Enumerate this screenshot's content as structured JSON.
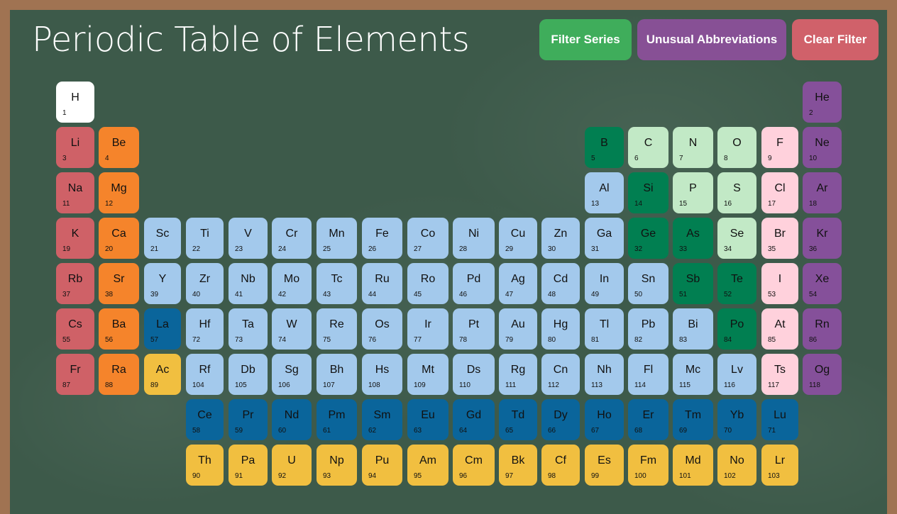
{
  "title": "Periodic Table of Elements",
  "buttons": {
    "filter_series": "Filter Series",
    "unusual_abbreviations": "Unusual Abbreviations",
    "clear_filter": "Clear Filter"
  },
  "colors": {
    "board": "#3d5a4a",
    "frame": "#a07352",
    "filter_series_button": "#3fad5b",
    "unusual_abbreviations_button": "#875095",
    "clear_filter_button": "#d0616a",
    "hydrogen": "#ffffff",
    "alkali": "#cf6167",
    "alkaline": "#f5842b",
    "transition": "#a3c9ec",
    "lanthanide": "#0a659b",
    "actinide": "#f1bf40",
    "metalloid": "#017f51",
    "nonmetal": "#c2e9c6",
    "halogen": "#ffd1dc",
    "noble": "#85509a"
  },
  "elements": [
    {
      "sym": "H",
      "num": 1,
      "row": 1,
      "col": 1,
      "cat": "hydrogen"
    },
    {
      "sym": "He",
      "num": 2,
      "row": 1,
      "col": 18,
      "cat": "noble"
    },
    {
      "sym": "Li",
      "num": 3,
      "row": 2,
      "col": 1,
      "cat": "alkali"
    },
    {
      "sym": "Be",
      "num": 4,
      "row": 2,
      "col": 2,
      "cat": "alkaline"
    },
    {
      "sym": "B",
      "num": 5,
      "row": 2,
      "col": 13,
      "cat": "metalloid"
    },
    {
      "sym": "C",
      "num": 6,
      "row": 2,
      "col": 14,
      "cat": "nonmetal"
    },
    {
      "sym": "N",
      "num": 7,
      "row": 2,
      "col": 15,
      "cat": "nonmetal"
    },
    {
      "sym": "O",
      "num": 8,
      "row": 2,
      "col": 16,
      "cat": "nonmetal"
    },
    {
      "sym": "F",
      "num": 9,
      "row": 2,
      "col": 17,
      "cat": "halogen"
    },
    {
      "sym": "Ne",
      "num": 10,
      "row": 2,
      "col": 18,
      "cat": "noble"
    },
    {
      "sym": "Na",
      "num": 11,
      "row": 3,
      "col": 1,
      "cat": "alkali"
    },
    {
      "sym": "Mg",
      "num": 12,
      "row": 3,
      "col": 2,
      "cat": "alkaline"
    },
    {
      "sym": "Al",
      "num": 13,
      "row": 3,
      "col": 13,
      "cat": "transition"
    },
    {
      "sym": "Si",
      "num": 14,
      "row": 3,
      "col": 14,
      "cat": "metalloid"
    },
    {
      "sym": "P",
      "num": 15,
      "row": 3,
      "col": 15,
      "cat": "nonmetal"
    },
    {
      "sym": "S",
      "num": 16,
      "row": 3,
      "col": 16,
      "cat": "nonmetal"
    },
    {
      "sym": "Cl",
      "num": 17,
      "row": 3,
      "col": 17,
      "cat": "halogen"
    },
    {
      "sym": "Ar",
      "num": 18,
      "row": 3,
      "col": 18,
      "cat": "noble"
    },
    {
      "sym": "K",
      "num": 19,
      "row": 4,
      "col": 1,
      "cat": "alkali"
    },
    {
      "sym": "Ca",
      "num": 20,
      "row": 4,
      "col": 2,
      "cat": "alkaline"
    },
    {
      "sym": "Sc",
      "num": 21,
      "row": 4,
      "col": 3,
      "cat": "transition"
    },
    {
      "sym": "Ti",
      "num": 22,
      "row": 4,
      "col": 4,
      "cat": "transition"
    },
    {
      "sym": "V",
      "num": 23,
      "row": 4,
      "col": 5,
      "cat": "transition"
    },
    {
      "sym": "Cr",
      "num": 24,
      "row": 4,
      "col": 6,
      "cat": "transition"
    },
    {
      "sym": "Mn",
      "num": 25,
      "row": 4,
      "col": 7,
      "cat": "transition"
    },
    {
      "sym": "Fe",
      "num": 26,
      "row": 4,
      "col": 8,
      "cat": "transition"
    },
    {
      "sym": "Co",
      "num": 27,
      "row": 4,
      "col": 9,
      "cat": "transition"
    },
    {
      "sym": "Ni",
      "num": 28,
      "row": 4,
      "col": 10,
      "cat": "transition"
    },
    {
      "sym": "Cu",
      "num": 29,
      "row": 4,
      "col": 11,
      "cat": "transition"
    },
    {
      "sym": "Zn",
      "num": 30,
      "row": 4,
      "col": 12,
      "cat": "transition"
    },
    {
      "sym": "Ga",
      "num": 31,
      "row": 4,
      "col": 13,
      "cat": "transition"
    },
    {
      "sym": "Ge",
      "num": 32,
      "row": 4,
      "col": 14,
      "cat": "metalloid"
    },
    {
      "sym": "As",
      "num": 33,
      "row": 4,
      "col": 15,
      "cat": "metalloid"
    },
    {
      "sym": "Se",
      "num": 34,
      "row": 4,
      "col": 16,
      "cat": "nonmetal"
    },
    {
      "sym": "Br",
      "num": 35,
      "row": 4,
      "col": 17,
      "cat": "halogen"
    },
    {
      "sym": "Kr",
      "num": 36,
      "row": 4,
      "col": 18,
      "cat": "noble"
    },
    {
      "sym": "Rb",
      "num": 37,
      "row": 5,
      "col": 1,
      "cat": "alkali"
    },
    {
      "sym": "Sr",
      "num": 38,
      "row": 5,
      "col": 2,
      "cat": "alkaline"
    },
    {
      "sym": "Y",
      "num": 39,
      "row": 5,
      "col": 3,
      "cat": "transition"
    },
    {
      "sym": "Zr",
      "num": 40,
      "row": 5,
      "col": 4,
      "cat": "transition"
    },
    {
      "sym": "Nb",
      "num": 41,
      "row": 5,
      "col": 5,
      "cat": "transition"
    },
    {
      "sym": "Mo",
      "num": 42,
      "row": 5,
      "col": 6,
      "cat": "transition"
    },
    {
      "sym": "Tc",
      "num": 43,
      "row": 5,
      "col": 7,
      "cat": "transition"
    },
    {
      "sym": "Ru",
      "num": 44,
      "row": 5,
      "col": 8,
      "cat": "transition"
    },
    {
      "sym": "Ro",
      "num": 45,
      "row": 5,
      "col": 9,
      "cat": "transition"
    },
    {
      "sym": "Pd",
      "num": 46,
      "row": 5,
      "col": 10,
      "cat": "transition"
    },
    {
      "sym": "Ag",
      "num": 47,
      "row": 5,
      "col": 11,
      "cat": "transition"
    },
    {
      "sym": "Cd",
      "num": 48,
      "row": 5,
      "col": 12,
      "cat": "transition"
    },
    {
      "sym": "In",
      "num": 49,
      "row": 5,
      "col": 13,
      "cat": "transition"
    },
    {
      "sym": "Sn",
      "num": 50,
      "row": 5,
      "col": 14,
      "cat": "transition"
    },
    {
      "sym": "Sb",
      "num": 51,
      "row": 5,
      "col": 15,
      "cat": "metalloid"
    },
    {
      "sym": "Te",
      "num": 52,
      "row": 5,
      "col": 16,
      "cat": "metalloid"
    },
    {
      "sym": "I",
      "num": 53,
      "row": 5,
      "col": 17,
      "cat": "halogen"
    },
    {
      "sym": "Xe",
      "num": 54,
      "row": 5,
      "col": 18,
      "cat": "noble"
    },
    {
      "sym": "Cs",
      "num": 55,
      "row": 6,
      "col": 1,
      "cat": "alkali"
    },
    {
      "sym": "Ba",
      "num": 56,
      "row": 6,
      "col": 2,
      "cat": "alkaline"
    },
    {
      "sym": "La",
      "num": 57,
      "row": 6,
      "col": 3,
      "cat": "lanthanide"
    },
    {
      "sym": "Hf",
      "num": 72,
      "row": 6,
      "col": 4,
      "cat": "transition"
    },
    {
      "sym": "Ta",
      "num": 73,
      "row": 6,
      "col": 5,
      "cat": "transition"
    },
    {
      "sym": "W",
      "num": 74,
      "row": 6,
      "col": 6,
      "cat": "transition"
    },
    {
      "sym": "Re",
      "num": 75,
      "row": 6,
      "col": 7,
      "cat": "transition"
    },
    {
      "sym": "Os",
      "num": 76,
      "row": 6,
      "col": 8,
      "cat": "transition"
    },
    {
      "sym": "Ir",
      "num": 77,
      "row": 6,
      "col": 9,
      "cat": "transition"
    },
    {
      "sym": "Pt",
      "num": 78,
      "row": 6,
      "col": 10,
      "cat": "transition"
    },
    {
      "sym": "Au",
      "num": 79,
      "row": 6,
      "col": 11,
      "cat": "transition"
    },
    {
      "sym": "Hg",
      "num": 80,
      "row": 6,
      "col": 12,
      "cat": "transition"
    },
    {
      "sym": "Tl",
      "num": 81,
      "row": 6,
      "col": 13,
      "cat": "transition"
    },
    {
      "sym": "Pb",
      "num": 82,
      "row": 6,
      "col": 14,
      "cat": "transition"
    },
    {
      "sym": "Bi",
      "num": 83,
      "row": 6,
      "col": 15,
      "cat": "transition"
    },
    {
      "sym": "Po",
      "num": 84,
      "row": 6,
      "col": 16,
      "cat": "metalloid"
    },
    {
      "sym": "At",
      "num": 85,
      "row": 6,
      "col": 17,
      "cat": "halogen"
    },
    {
      "sym": "Rn",
      "num": 86,
      "row": 6,
      "col": 18,
      "cat": "noble"
    },
    {
      "sym": "Fr",
      "num": 87,
      "row": 7,
      "col": 1,
      "cat": "alkali"
    },
    {
      "sym": "Ra",
      "num": 88,
      "row": 7,
      "col": 2,
      "cat": "alkaline"
    },
    {
      "sym": "Ac",
      "num": 89,
      "row": 7,
      "col": 3,
      "cat": "actinide"
    },
    {
      "sym": "Rf",
      "num": 104,
      "row": 7,
      "col": 4,
      "cat": "transition"
    },
    {
      "sym": "Db",
      "num": 105,
      "row": 7,
      "col": 5,
      "cat": "transition"
    },
    {
      "sym": "Sg",
      "num": 106,
      "row": 7,
      "col": 6,
      "cat": "transition"
    },
    {
      "sym": "Bh",
      "num": 107,
      "row": 7,
      "col": 7,
      "cat": "transition"
    },
    {
      "sym": "Hs",
      "num": 108,
      "row": 7,
      "col": 8,
      "cat": "transition"
    },
    {
      "sym": "Mt",
      "num": 109,
      "row": 7,
      "col": 9,
      "cat": "transition"
    },
    {
      "sym": "Ds",
      "num": 110,
      "row": 7,
      "col": 10,
      "cat": "transition"
    },
    {
      "sym": "Rg",
      "num": 111,
      "row": 7,
      "col": 11,
      "cat": "transition"
    },
    {
      "sym": "Cn",
      "num": 112,
      "row": 7,
      "col": 12,
      "cat": "transition"
    },
    {
      "sym": "Nh",
      "num": 113,
      "row": 7,
      "col": 13,
      "cat": "transition"
    },
    {
      "sym": "Fl",
      "num": 114,
      "row": 7,
      "col": 14,
      "cat": "transition"
    },
    {
      "sym": "Mc",
      "num": 115,
      "row": 7,
      "col": 15,
      "cat": "transition"
    },
    {
      "sym": "Lv",
      "num": 116,
      "row": 7,
      "col": 16,
      "cat": "transition"
    },
    {
      "sym": "Ts",
      "num": 117,
      "row": 7,
      "col": 17,
      "cat": "halogen"
    },
    {
      "sym": "Og",
      "num": 118,
      "row": 7,
      "col": 18,
      "cat": "noble"
    },
    {
      "sym": "Ce",
      "num": 58,
      "row": 8,
      "col": 4,
      "cat": "lanthanide"
    },
    {
      "sym": "Pr",
      "num": 59,
      "row": 8,
      "col": 5,
      "cat": "lanthanide"
    },
    {
      "sym": "Nd",
      "num": 60,
      "row": 8,
      "col": 6,
      "cat": "lanthanide"
    },
    {
      "sym": "Pm",
      "num": 61,
      "row": 8,
      "col": 7,
      "cat": "lanthanide"
    },
    {
      "sym": "Sm",
      "num": 62,
      "row": 8,
      "col": 8,
      "cat": "lanthanide"
    },
    {
      "sym": "Eu",
      "num": 63,
      "row": 8,
      "col": 9,
      "cat": "lanthanide"
    },
    {
      "sym": "Gd",
      "num": 64,
      "row": 8,
      "col": 10,
      "cat": "lanthanide"
    },
    {
      "sym": "Td",
      "num": 65,
      "row": 8,
      "col": 11,
      "cat": "lanthanide"
    },
    {
      "sym": "Dy",
      "num": 66,
      "row": 8,
      "col": 12,
      "cat": "lanthanide"
    },
    {
      "sym": "Ho",
      "num": 67,
      "row": 8,
      "col": 13,
      "cat": "lanthanide"
    },
    {
      "sym": "Er",
      "num": 68,
      "row": 8,
      "col": 14,
      "cat": "lanthanide"
    },
    {
      "sym": "Tm",
      "num": 69,
      "row": 8,
      "col": 15,
      "cat": "lanthanide"
    },
    {
      "sym": "Yb",
      "num": 70,
      "row": 8,
      "col": 16,
      "cat": "lanthanide"
    },
    {
      "sym": "Lu",
      "num": 71,
      "row": 8,
      "col": 17,
      "cat": "lanthanide"
    },
    {
      "sym": "Th",
      "num": 90,
      "row": 9,
      "col": 4,
      "cat": "actinide"
    },
    {
      "sym": "Pa",
      "num": 91,
      "row": 9,
      "col": 5,
      "cat": "actinide"
    },
    {
      "sym": "U",
      "num": 92,
      "row": 9,
      "col": 6,
      "cat": "actinide"
    },
    {
      "sym": "Np",
      "num": 93,
      "row": 9,
      "col": 7,
      "cat": "actinide"
    },
    {
      "sym": "Pu",
      "num": 94,
      "row": 9,
      "col": 8,
      "cat": "actinide"
    },
    {
      "sym": "Am",
      "num": 95,
      "row": 9,
      "col": 9,
      "cat": "actinide"
    },
    {
      "sym": "Cm",
      "num": 96,
      "row": 9,
      "col": 10,
      "cat": "actinide"
    },
    {
      "sym": "Bk",
      "num": 97,
      "row": 9,
      "col": 11,
      "cat": "actinide"
    },
    {
      "sym": "Cf",
      "num": 98,
      "row": 9,
      "col": 12,
      "cat": "actinide"
    },
    {
      "sym": "Es",
      "num": 99,
      "row": 9,
      "col": 13,
      "cat": "actinide"
    },
    {
      "sym": "Fm",
      "num": 100,
      "row": 9,
      "col": 14,
      "cat": "actinide"
    },
    {
      "sym": "Md",
      "num": 101,
      "row": 9,
      "col": 15,
      "cat": "actinide"
    },
    {
      "sym": "No",
      "num": 102,
      "row": 9,
      "col": 16,
      "cat": "actinide"
    },
    {
      "sym": "Lr",
      "num": 103,
      "row": 9,
      "col": 17,
      "cat": "actinide"
    }
  ]
}
